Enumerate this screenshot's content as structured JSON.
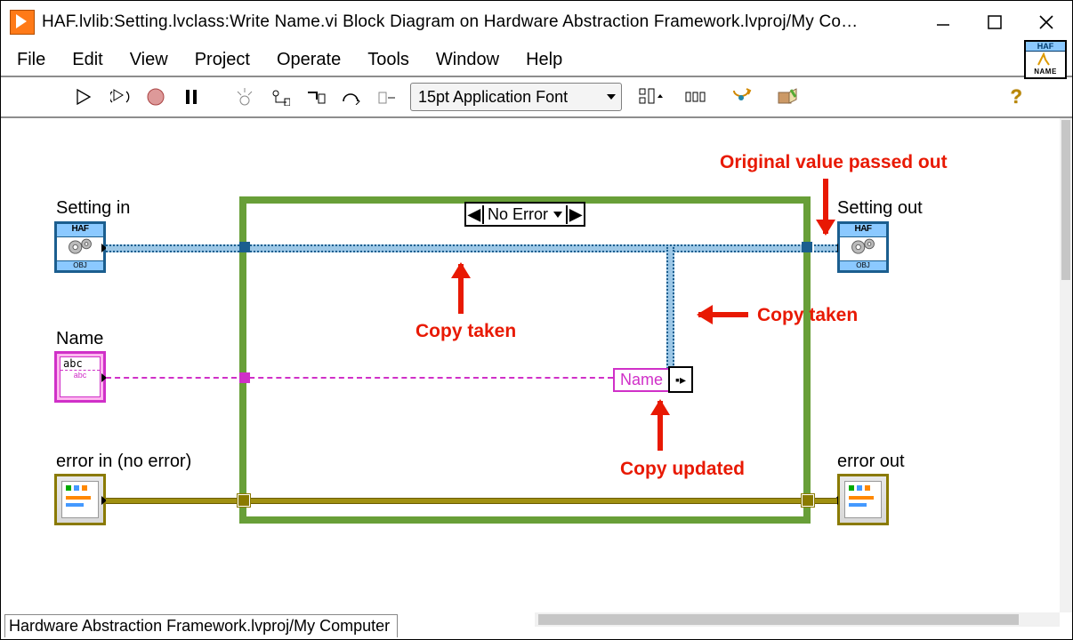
{
  "titlebar": {
    "title": "HAF.lvlib:Setting.lvclass:Write Name.vi Block Diagram on Hardware Abstraction Framework.lvproj/My Co…"
  },
  "menu": {
    "file": "File",
    "edit": "Edit",
    "view": "View",
    "project": "Project",
    "operate": "Operate",
    "tools": "Tools",
    "window": "Window",
    "help": "Help"
  },
  "toolbar": {
    "font_label": "15pt Application Font"
  },
  "vi_icon": {
    "top": "HAF",
    "bottom": "NAME"
  },
  "canvas": {
    "labels": {
      "setting_in": "Setting in",
      "setting_out": "Setting out",
      "name": "Name",
      "error_in": "error in (no error)",
      "error_out": "error out",
      "case": "No Error"
    },
    "nodes": {
      "haf_header": "HAF",
      "obj_footer": "OBJ",
      "abc": "abc",
      "unbundle_field": "Name"
    },
    "annotations": {
      "original_passed": "Original value passed out",
      "copy_taken_1": "Copy taken",
      "copy_taken_2": "Copy taken",
      "copy_updated": "Copy updated"
    }
  },
  "statusbar": {
    "path": "Hardware Abstraction Framework.lvproj/My Computer"
  }
}
